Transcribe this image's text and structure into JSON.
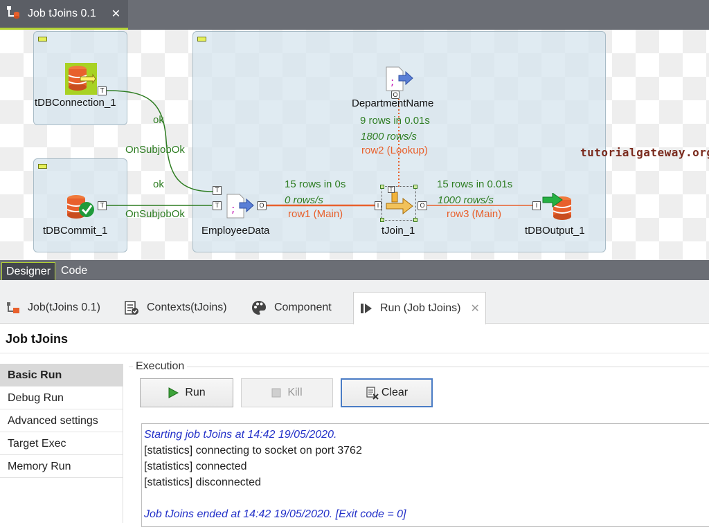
{
  "editor": {
    "tab_title": "Job tJoins 0.1",
    "close_glyph": "✕"
  },
  "canvas": {
    "components": {
      "connection": "tDBConnection_1",
      "commit": "tDBCommit_1",
      "department": "DepartmentName",
      "employee": "EmployeeData",
      "join": "tJoin_1",
      "output": "tDBOutput_1"
    },
    "links": {
      "ok_top": "ok",
      "subjob_top": "OnSubjobOk",
      "ok_bottom": "ok",
      "subjob_bottom": "OnSubjobOk",
      "row2_stats": "9 rows in 0.01s",
      "row2_rate": "1800 rows/s",
      "row2_label": "row2 (Lookup)",
      "row1_stats": "15 rows in 0s",
      "row1_rate": "0 rows/s",
      "row1_label": "row1 (Main)",
      "row3_stats": "15 rows in 0.01s",
      "row3_rate": "1000 rows/s",
      "row3_label": "row3 (Main)"
    },
    "watermark": "tutorialgateway.org",
    "colors": {
      "db_orange": "#e8602c",
      "link_green": "#2e7d22",
      "flow_orange": "#e8602c"
    }
  },
  "view_tabs": {
    "designer": "Designer",
    "code": "Code"
  },
  "panel_tabs": {
    "job": "Job(tJoins 0.1)",
    "contexts": "Contexts(tJoins)",
    "component": "Component",
    "run": "Run (Job tJoins)"
  },
  "run_title": "Job tJoins",
  "run_menu": [
    "Basic Run",
    "Debug Run",
    "Advanced settings",
    "Target Exec",
    "Memory Run"
  ],
  "execution": {
    "group_title": "Execution",
    "run_label": "Run",
    "kill_label": "Kill",
    "clear_label": "Clear"
  },
  "console": {
    "lines": [
      "Starting job tJoins at 14:42 19/05/2020.",
      "[statistics] connecting to socket on port 3762",
      "[statistics] connected",
      "[statistics] disconnected",
      "",
      "Job tJoins ended at 14:42 19/05/2020. [Exit code  = 0]"
    ]
  }
}
